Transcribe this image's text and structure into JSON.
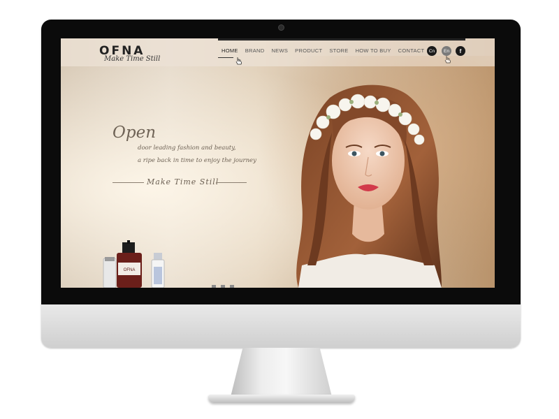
{
  "brand": {
    "logo": "OFNA",
    "tagline": "Make Time Still"
  },
  "nav": {
    "items": [
      "HOME",
      "BRAND",
      "NEWS",
      "PRODUCT",
      "STORE",
      "HOW TO BUY",
      "CONTACT"
    ],
    "active": "HOME"
  },
  "languages": {
    "cn": "Cn",
    "en": "En"
  },
  "social": {
    "facebook": "f"
  },
  "hero": {
    "script_title": "Open",
    "line1": "door leading fashion and beauty,",
    "line2": "a ripe back in time to enjoy the journey",
    "slogan": "Make Time Still"
  },
  "product_label": "OFNA",
  "slider": {
    "dot_count": 3
  },
  "colors": {
    "bezel": "#0b0b0b",
    "accent_text": "#6d6154",
    "lips": "#d23a4a",
    "hair": "#8a4f2c"
  }
}
